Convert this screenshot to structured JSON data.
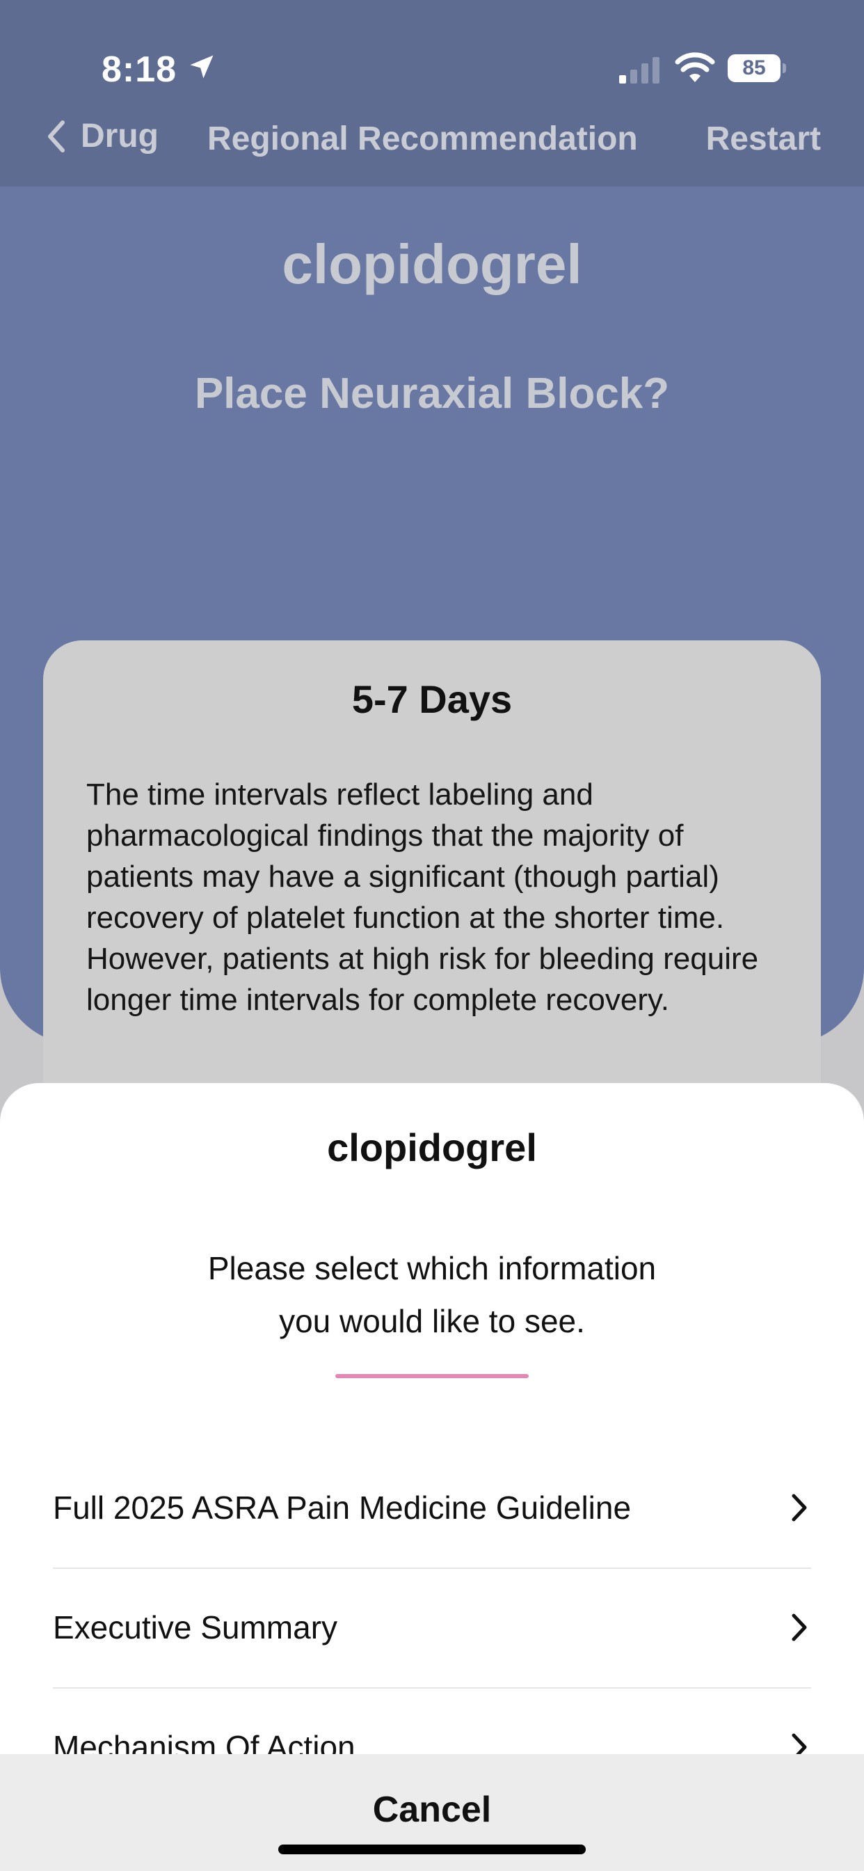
{
  "status_bar": {
    "time": "8:18",
    "battery": "85",
    "icons": [
      "location-arrow-icon",
      "cellular-signal-icon",
      "wifi-icon",
      "battery-icon"
    ]
  },
  "nav": {
    "back_label": "Drug",
    "title": "Regional Recommendation",
    "restart_label": "Restart"
  },
  "main": {
    "drug_name": "clopidogrel",
    "question": "Place Neuraxial Block?",
    "result": {
      "title": "5-7 Days",
      "body": "The time intervals reflect labeling and pharmacological findings that the majority of patients may have a significant (though partial) recovery of platelet function at the shorter time. However, patients at high risk for bleeding require longer time intervals for complete recovery."
    }
  },
  "sheet": {
    "title": "clopidogrel",
    "prompt_line1": "Please select which information",
    "prompt_line2": "you would like to see.",
    "accent_color": "#e288b5",
    "options": [
      {
        "label": "Full 2025 ASRA Pain Medicine Guideline"
      },
      {
        "label": "Executive Summary"
      },
      {
        "label": "Mechanism Of Action"
      }
    ],
    "cancel_label": "Cancel"
  },
  "colors": {
    "nav_background": "#5e6c92",
    "screen_background": "#6878a3",
    "card_background": "#cecece"
  }
}
